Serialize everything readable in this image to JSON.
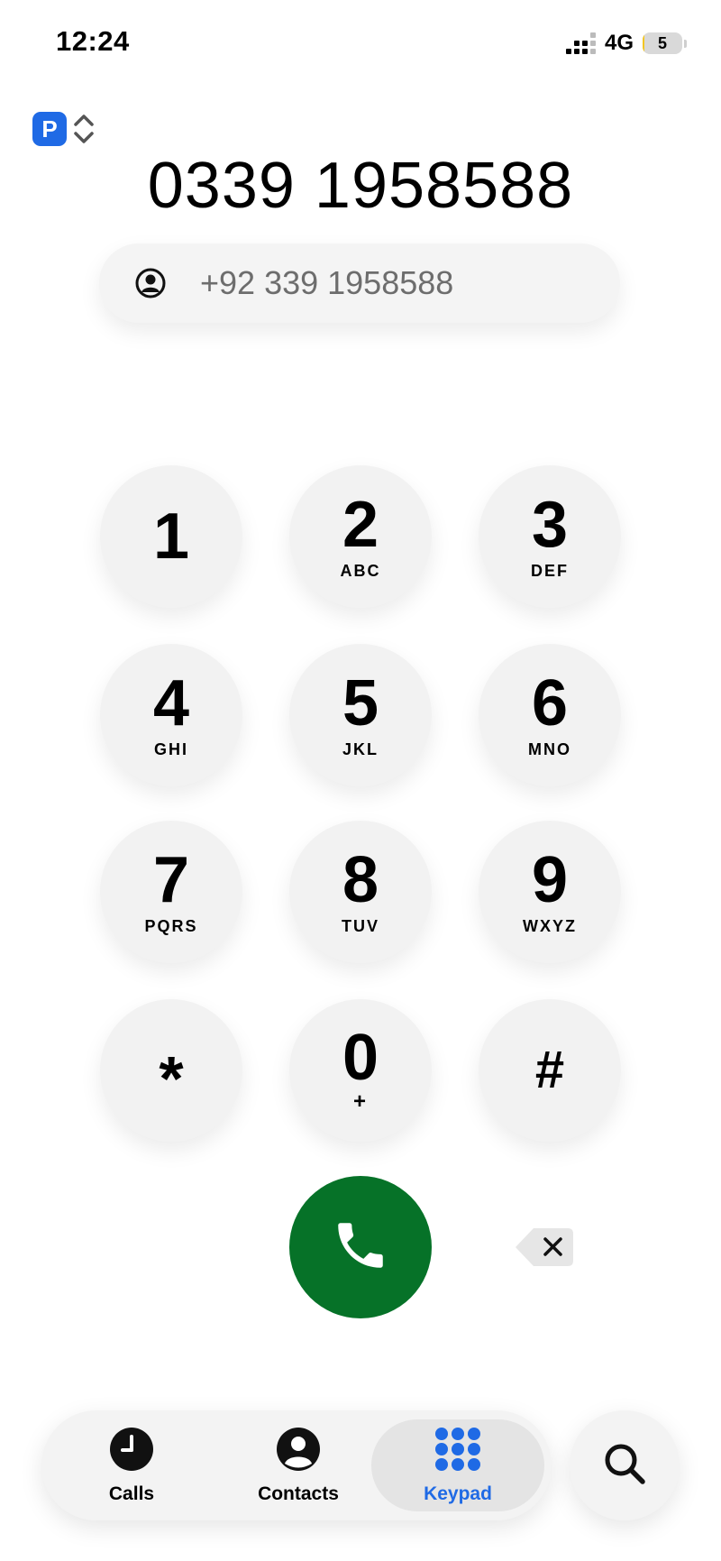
{
  "status_bar": {
    "time": "12:24",
    "network": "4G",
    "battery_level": "5",
    "battery_fraction": 0.05
  },
  "sim_selector": {
    "badge": "P"
  },
  "dialer": {
    "number": "0339 1958588",
    "suggestion": "+92 339 1958588"
  },
  "keypad": {
    "keys": [
      {
        "digit": "1",
        "letters": ""
      },
      {
        "digit": "2",
        "letters": "ABC"
      },
      {
        "digit": "3",
        "letters": "DEF"
      },
      {
        "digit": "4",
        "letters": "GHI"
      },
      {
        "digit": "5",
        "letters": "JKL"
      },
      {
        "digit": "6",
        "letters": "MNO"
      },
      {
        "digit": "7",
        "letters": "PQRS"
      },
      {
        "digit": "8",
        "letters": "TUV"
      },
      {
        "digit": "9",
        "letters": "WXYZ"
      },
      {
        "digit": "*",
        "letters": ""
      },
      {
        "digit": "0",
        "letters": "+"
      },
      {
        "digit": "#",
        "letters": ""
      }
    ]
  },
  "tabs": {
    "calls": "Calls",
    "contacts": "Contacts",
    "keypad": "Keypad",
    "active": "Keypad"
  },
  "colors": {
    "accent": "#1f6ae5",
    "call_green": "#067228",
    "key_bg": "#f2f2f2"
  },
  "icons": {
    "call": "phone-icon",
    "delete": "backspace-icon",
    "search": "search-icon",
    "calls_tab": "clock-icon",
    "contacts_tab": "person-icon",
    "keypad_tab": "keypad-grid-icon"
  }
}
